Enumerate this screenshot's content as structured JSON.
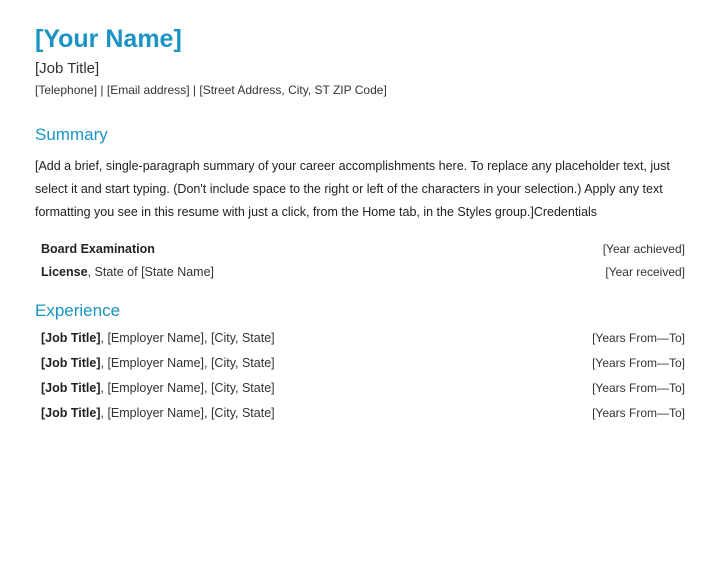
{
  "header": {
    "name": "[Your Name]",
    "job_title": "[Job Title]",
    "telephone": "[Telephone]",
    "email": "[Email address]",
    "address": "[Street Address, City, ST ZIP Code]",
    "sep": "  |  "
  },
  "summary": {
    "heading": "Summary",
    "text": "[Add a brief, single-paragraph summary of your career accomplishments here. To replace any placeholder text, just select it and start typing. (Don't include space to the right or left of the characters in your selection.) Apply any text formatting you see in this resume with just a click, from the Home tab, in the Styles group.]Credentials"
  },
  "credentials": [
    {
      "left_strong": "Board Examination",
      "left_rest": "",
      "right": "[Year achieved]"
    },
    {
      "left_strong": "License",
      "left_rest": ", State of [State Name]",
      "right": "[Year received]"
    }
  ],
  "experience": {
    "heading": "Experience",
    "items": [
      {
        "title": "[Job Title]",
        "rest": ", [Employer Name], [City, State]",
        "years": "[Years From—To]"
      },
      {
        "title": "[Job Title]",
        "rest": ", [Employer Name], [City, State]",
        "years": "[Years From—To]"
      },
      {
        "title": "[Job Title]",
        "rest": ", [Employer Name], [City, State]",
        "years": "[Years From—To]"
      },
      {
        "title": "[Job Title]",
        "rest": ", [Employer Name], [City, State]",
        "years": "[Years From—To]"
      }
    ]
  }
}
